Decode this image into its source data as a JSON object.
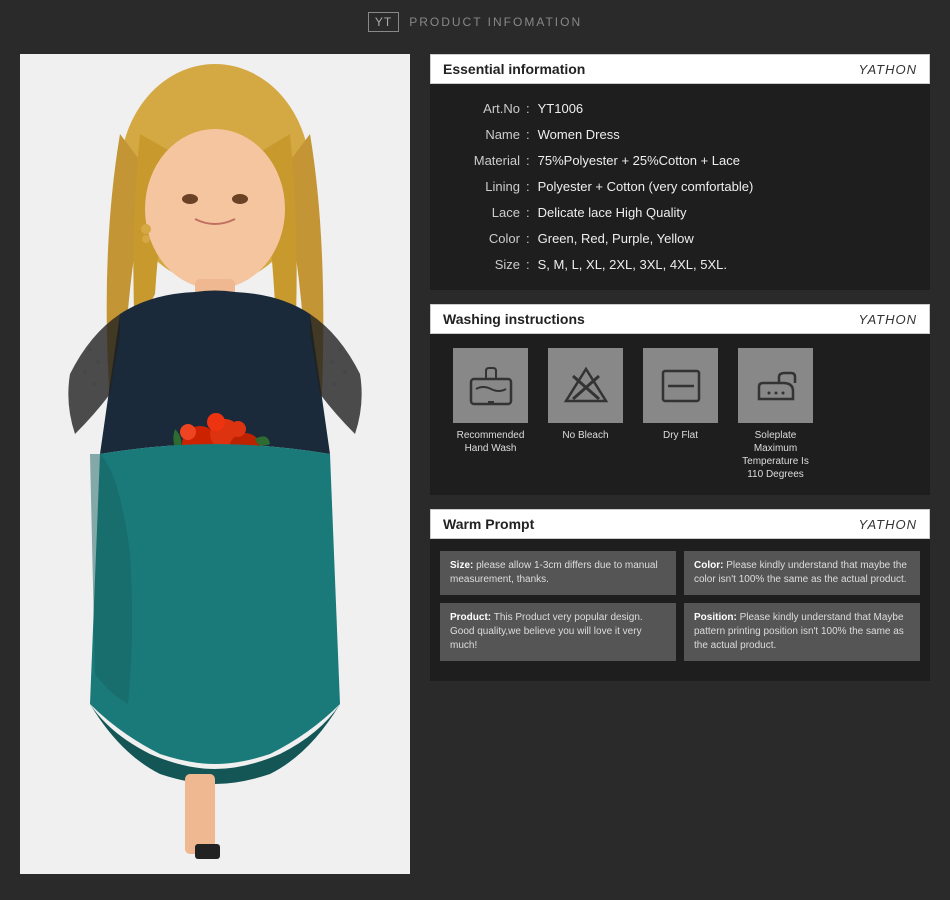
{
  "header": {
    "logo": "YT",
    "title": "PRODUCT INFOMATION"
  },
  "product": {
    "art_no_label": "Art.No",
    "art_no_value": "YT1006",
    "name_label": "Name",
    "name_value": "Women Dress",
    "material_label": "Material",
    "material_value": "75%Polyester + 25%Cotton + Lace",
    "lining_label": "Lining",
    "lining_value": "Polyester + Cotton (very comfortable)",
    "lace_label": "Lace",
    "lace_value": "Delicate lace High Quality",
    "color_label": "Color",
    "color_value": "Green,  Red,  Purple,  Yellow",
    "size_label": "Size",
    "size_value": "S, M, L, XL, 2XL, 3XL, 4XL, 5XL."
  },
  "sections": {
    "essential": "Essential information",
    "washing": "Washing instructions",
    "warm": "Warm Prompt",
    "brand": "YATHON"
  },
  "washing": {
    "icons": [
      {
        "label": "Recommended\nHand Wash",
        "type": "hand-wash"
      },
      {
        "label": "No Bleach",
        "type": "no-bleach"
      },
      {
        "label": "Dry Flat",
        "type": "dry-flat"
      },
      {
        "label": "Soleplate Maximum\nTemperature Is\n110 Degrees",
        "type": "iron"
      }
    ]
  },
  "warm_prompt": {
    "size_label": "Size:",
    "size_text": "please allow 1-3cm differs due to manual measurement, thanks.",
    "color_label": "Color:",
    "color_text": "Please kindly understand that maybe the color isn't 100% the same as the actual product.",
    "product_label": "Product:",
    "product_text": "This Product very popular design. Good quality,we believe you will love it very much!",
    "position_label": "Position:",
    "position_text": "Please kindly understand that Maybe pattern printing position isn't 100% the same as the actual product."
  }
}
